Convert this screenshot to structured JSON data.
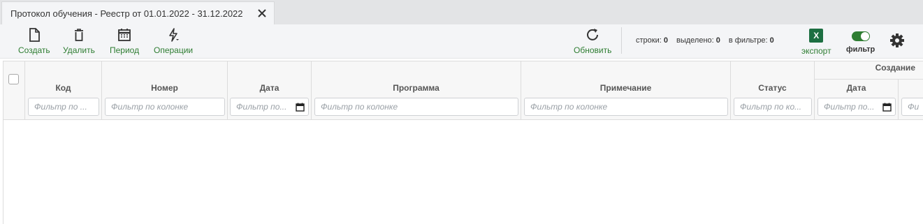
{
  "tab": {
    "title": "Протокол обучения - Реестр от 01.01.2022 - 31.12.2022"
  },
  "toolbar": {
    "create_label": "Создать",
    "delete_label": "Удалить",
    "period_label": "Период",
    "operations_label": "Операции",
    "refresh_label": "Обновить",
    "export_label": "экспорт",
    "export_icon_text": "X",
    "filter_label": "фильтр",
    "filter_toggle_on": true
  },
  "stats": {
    "rows_label": "строки:",
    "rows_value": "0",
    "selected_label": "выделено:",
    "selected_value": "0",
    "filtered_label": "в фильтре:",
    "filtered_value": "0"
  },
  "grid": {
    "group_creation": "Создание",
    "columns": {
      "code": {
        "title": "Код",
        "filter": "Фильтр по ..."
      },
      "number": {
        "title": "Номер",
        "filter": "Фильтр по колонке"
      },
      "date": {
        "title": "Дата",
        "filter": "Фильтр по..."
      },
      "program": {
        "title": "Программа",
        "filter": "Фильтр по колонке"
      },
      "note": {
        "title": "Примечание",
        "filter": "Фильтр по колонке"
      },
      "status": {
        "title": "Статус",
        "filter": "Фильтр по ко..."
      },
      "created_date": {
        "title": "Дата",
        "filter": "Фильтр по..."
      },
      "created_next": {
        "filter": "Фи"
      }
    }
  },
  "colors": {
    "accent": "#2e7d32",
    "excel": "#1d6f42"
  }
}
